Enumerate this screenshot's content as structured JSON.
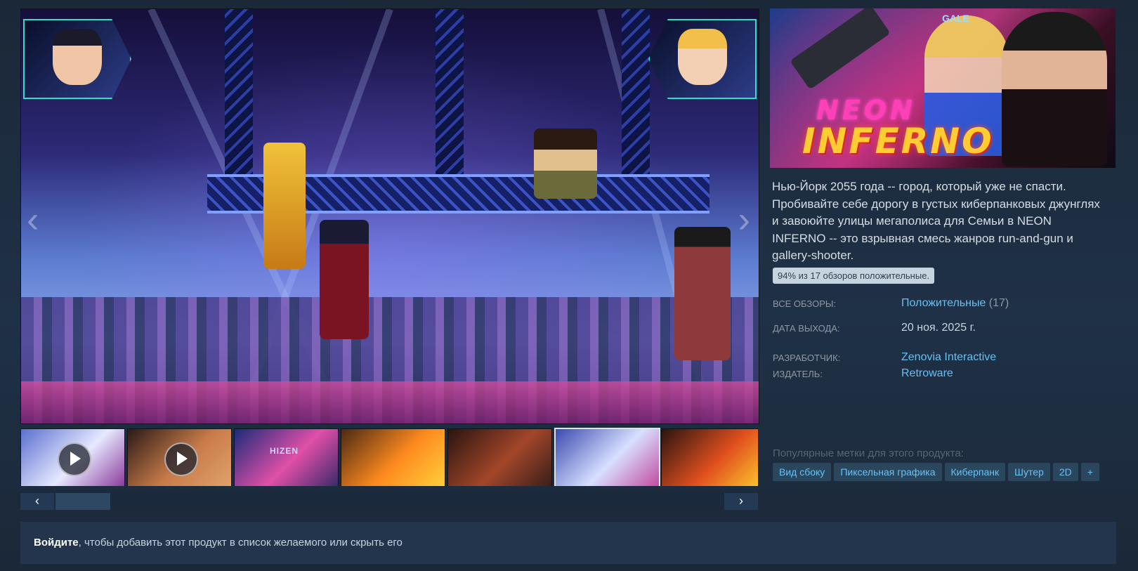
{
  "thumbnails": [
    {
      "kind": "video",
      "colors": [
        "#5a6fd0",
        "#e6e9ff",
        "#8a3a9a"
      ]
    },
    {
      "kind": "video",
      "colors": [
        "#2a1a16",
        "#c97b4a",
        "#e0a36a"
      ]
    },
    {
      "kind": "image",
      "colors": [
        "#1a2b7a",
        "#e14fa8",
        "#3a2a6a"
      ],
      "label": "HIZEN"
    },
    {
      "kind": "image",
      "colors": [
        "#4a2a14",
        "#ff8a1f",
        "#ffcf3a"
      ]
    },
    {
      "kind": "image",
      "colors": [
        "#2a140f",
        "#a2462a",
        "#3a1e18"
      ]
    },
    {
      "kind": "image",
      "colors": [
        "#3a4ab0",
        "#d8e0ff",
        "#c24aa0"
      ],
      "active": true
    },
    {
      "kind": "image",
      "colors": [
        "#2a1410",
        "#e1501f",
        "#ffce2e"
      ]
    }
  ],
  "nav": {
    "prev": "‹",
    "next": "›"
  },
  "scroll": {
    "left": "‹",
    "right": "›"
  },
  "capsule": {
    "logo_line1": "NEON",
    "logo_line2": "INFERNO",
    "sign": "GALE"
  },
  "description": "Нью-Йорк 2055 года -- город, который уже не спасти. Пробивайте себе дорогу в густых киберпанковых джунглях и завоюйте улицы мегаполиса для Семьи в NEON INFERNO -- это взрывная смесь жанров run-and-gun и gallery-shooter.",
  "review_tooltip": "94% из 17 обзоров положительные.",
  "details": {
    "all_reviews_label": "ВСЕ ОБЗОРЫ:",
    "all_reviews_value": "Положительные",
    "all_reviews_count": "(17)",
    "release_label": "ДАТА ВЫХОДА:",
    "release_value": "20 ноя. 2025 г.",
    "developer_label": "РАЗРАБОТЧИК:",
    "developer_value": "Zenovia Interactive",
    "publisher_label": "ИЗДАТЕЛЬ:",
    "publisher_value": "Retroware"
  },
  "tags_title": "Популярные метки для этого продукта:",
  "tags": [
    "Вид сбоку",
    "Пиксельная графика",
    "Киберпанк",
    "Шутер",
    "2D",
    "+"
  ],
  "signin": {
    "link": "Войдите",
    "rest": ", чтобы добавить этот продукт в список желаемого или скрыть его"
  },
  "colors": {
    "link": "#66c0f4",
    "tag_bg": "#2a475e",
    "tag_text": "#67c1f5",
    "page_bg": "#1b2838"
  }
}
